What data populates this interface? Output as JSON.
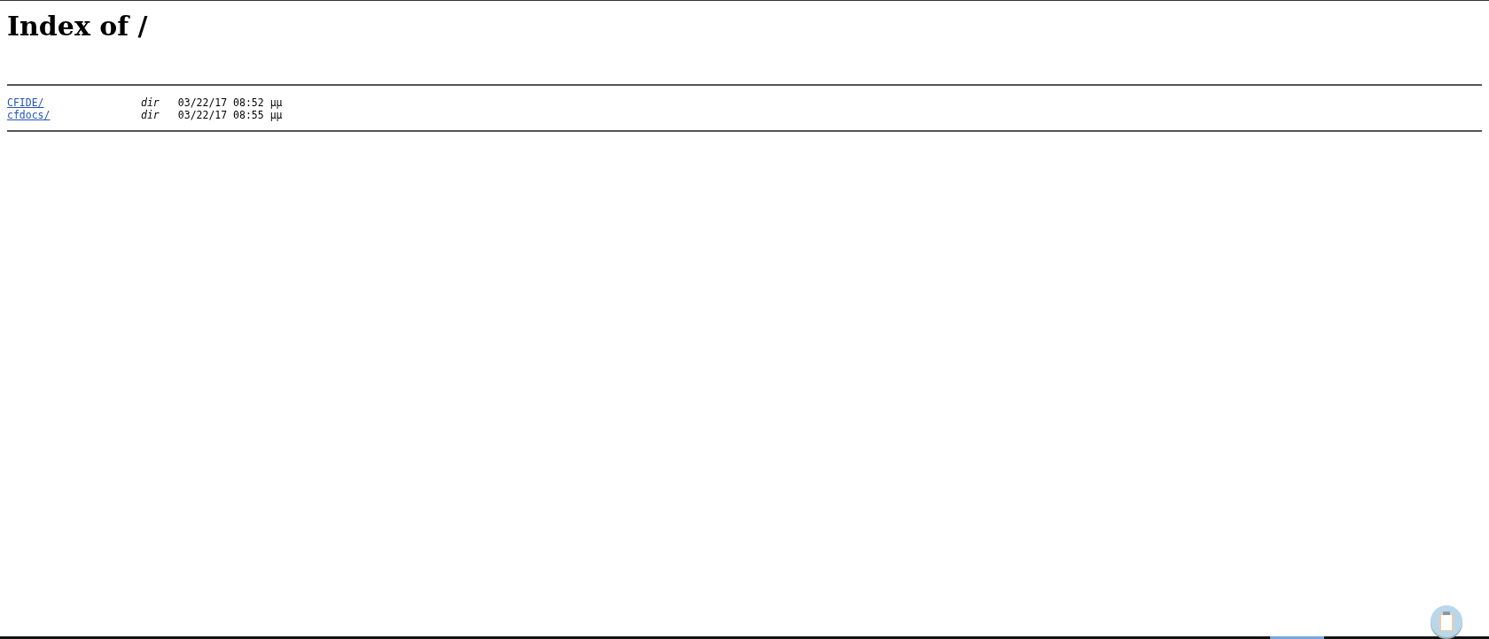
{
  "title": "Index of /",
  "entries": [
    {
      "name": "CFIDE/",
      "type": "dir",
      "modified": "03/22/17 08:52 μμ"
    },
    {
      "name": "cfdocs/",
      "type": "dir",
      "modified": "03/22/17 08:55 μμ"
    }
  ]
}
